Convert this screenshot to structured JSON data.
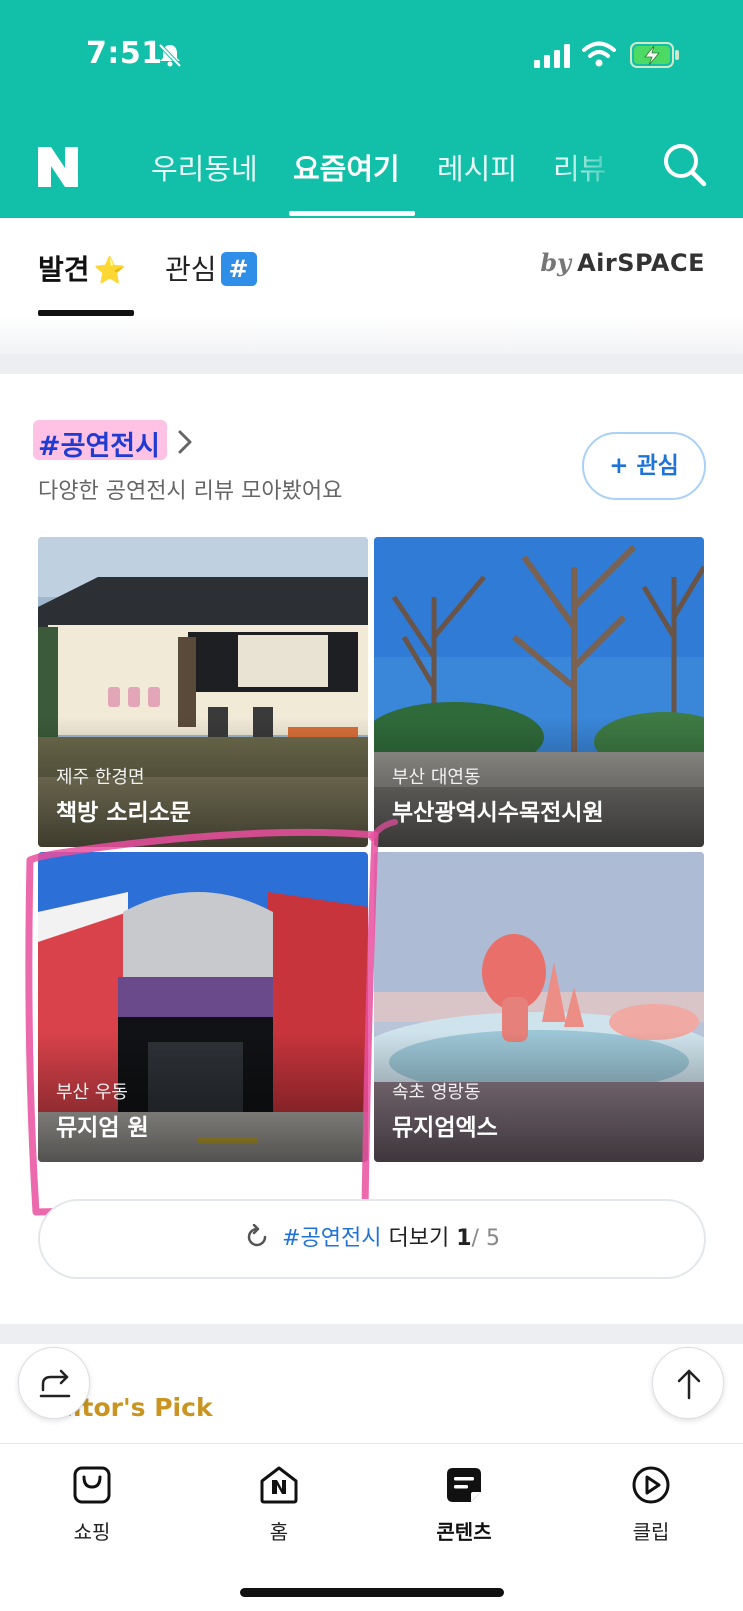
{
  "status_bar": {
    "time": "7:51"
  },
  "header": {
    "logo": "N",
    "tabs": [
      {
        "label": "우리동네",
        "active": false
      },
      {
        "label": "요즘여기",
        "active": true
      },
      {
        "label": "레시피",
        "active": false
      },
      {
        "label": "리뷰",
        "active": false
      }
    ],
    "accent_color": "#12bfa8"
  },
  "subtabs": {
    "discover_label": "발견",
    "discover_emoji": "⭐",
    "interest_label": "관심",
    "interest_badge": "#",
    "by_label": "by",
    "partner_label": "AirSPACE"
  },
  "section": {
    "title": "#공연전시",
    "subtitle": "다양한 공연전시 리뷰 모아봤어요",
    "interest_button": "+ 관심"
  },
  "cards": [
    {
      "location": "제주 한경면",
      "name": "책방 소리소문"
    },
    {
      "location": "부산 대연동",
      "name": "부산광역시수목전시원"
    },
    {
      "location": "부산 우동",
      "name": "뮤지엄 원"
    },
    {
      "location": "속초 영랑동",
      "name": "뮤지엄엑스"
    }
  ],
  "more": {
    "tag": "#공연전시",
    "label": "더보기",
    "current": "1",
    "separator": "/",
    "total": "5"
  },
  "editors_pick": {
    "label": "Editor's Pick"
  },
  "bottom_nav": [
    {
      "label": "쇼핑",
      "icon": "shopping-bag-icon",
      "active": false
    },
    {
      "label": "홈",
      "icon": "home-icon",
      "active": false
    },
    {
      "label": "콘텐츠",
      "icon": "contents-icon",
      "active": true
    },
    {
      "label": "클립",
      "icon": "clip-play-icon",
      "active": false
    }
  ]
}
